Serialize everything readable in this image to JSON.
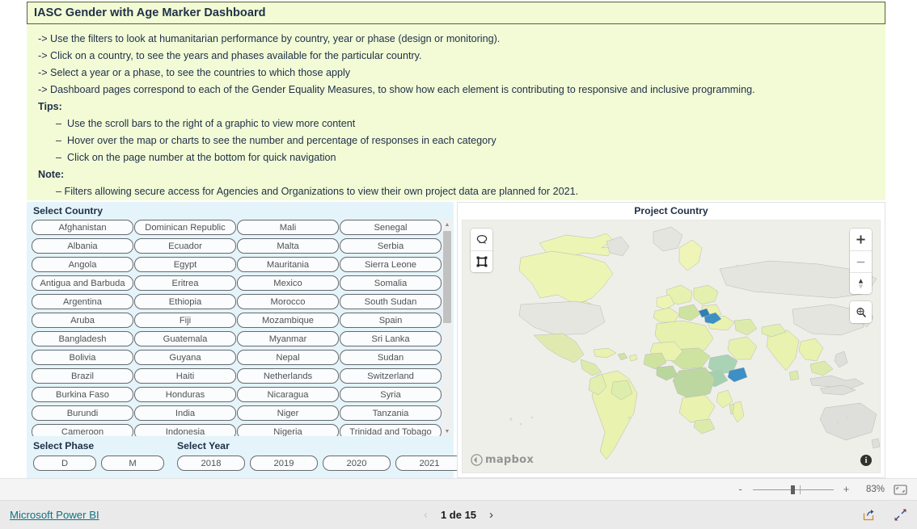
{
  "report": {
    "title": "IASC Gender with Age Marker Dashboard",
    "instructions": [
      {
        "text": "-> Use the filters to look at humanitarian performance by country, year or phase (design or monitoring).",
        "style": "normal"
      },
      {
        "text": "-> Click on a country, to see the years and phases available for the particular country.",
        "style": "normal"
      },
      {
        "text": "-> Select a year or a phase, to see the countries to which those apply",
        "style": "normal"
      },
      {
        "text": "-> Dashboard pages correspond to each of the Gender Equality Measures, to show how each element is contributing to responsive and inclusive programming.",
        "style": "normal"
      },
      {
        "text": "Tips:",
        "style": "bold"
      },
      {
        "text": "–  Use the scroll bars to the right of a graphic to view more content",
        "style": "indent"
      },
      {
        "text": "–  Hover over the map or charts to see the number and percentage of responses in each category",
        "style": "indent"
      },
      {
        "text": "–  Click on the page number at the bottom for quick navigation",
        "style": "indent"
      },
      {
        "text": "Note:",
        "style": "bold"
      },
      {
        "text": "– Filters allowing secure access for Agencies and Organizations to view their own project data are planned for 2021.",
        "style": "indent"
      }
    ]
  },
  "filters": {
    "country_label": "Select Country",
    "phase_label": "Select Phase",
    "year_label": "Select Year",
    "countries": [
      "Afghanistan",
      "Dominican Republic",
      "Mali",
      "Senegal",
      "Albania",
      "Ecuador",
      "Malta",
      "Serbia",
      "Angola",
      "Egypt",
      "Mauritania",
      "Sierra Leone",
      "Antigua and Barbuda",
      "Eritrea",
      "Mexico",
      "Somalia",
      "Argentina",
      "Ethiopia",
      "Morocco",
      "South Sudan",
      "Aruba",
      "Fiji",
      "Mozambique",
      "Spain",
      "Bangladesh",
      "Guatemala",
      "Myanmar",
      "Sri Lanka",
      "Bolivia",
      "Guyana",
      "Nepal",
      "Sudan",
      "Brazil",
      "Haiti",
      "Netherlands",
      "Switzerland",
      "Burkina Faso",
      "Honduras",
      "Nicaragua",
      "Syria",
      "Burundi",
      "India",
      "Niger",
      "Tanzania",
      "Cameroon",
      "Indonesia",
      "Nigeria",
      "Trinidad and Tobago"
    ],
    "phases": [
      "D",
      "M"
    ],
    "years": [
      "2018",
      "2019",
      "2020",
      "2021"
    ]
  },
  "map": {
    "title": "Project Country",
    "attribution": "mapbox",
    "controls": {
      "lasso_select": "lasso-select",
      "rectangle_select": "rectangle-select",
      "zoom_in": "+",
      "zoom_out": "–",
      "compass": "compass",
      "search": "search"
    }
  },
  "statusbar": {
    "zoom_out_label": "-",
    "zoom_in_label": "+",
    "zoom_percent": "83%",
    "fit_label": "fit-to-page"
  },
  "footer": {
    "brand": "Microsoft Power BI",
    "prev": "‹",
    "page_label": "1 de 15",
    "next": "›"
  },
  "colors": {
    "title_bg": "#f2fbd4",
    "panel_bg": "#f3fbd6",
    "filter_bg": "#e4f4fa",
    "map_bg": "#efefea",
    "map_land_light": "#e9f2ae",
    "map_land_mid": "#bcd8a0",
    "map_land_dark": "#9bcbb3",
    "map_highlight": "#3d8fc4",
    "brand_link": "#0d7383"
  }
}
